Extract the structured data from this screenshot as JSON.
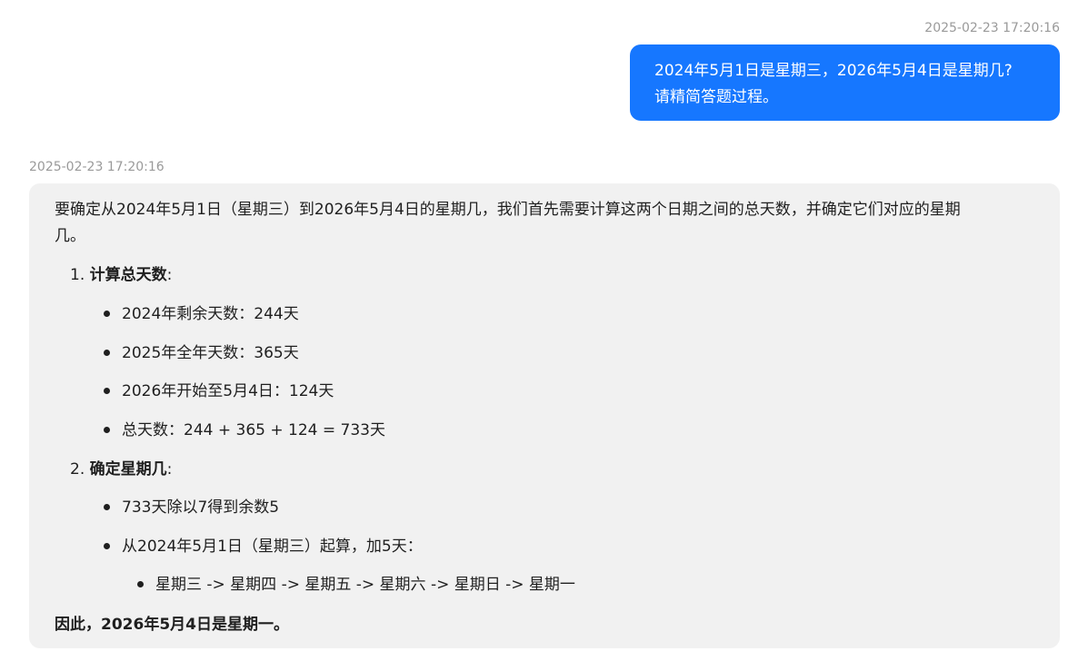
{
  "user_message": {
    "timestamp": "2025-02-23 17:20:16",
    "line1": "2024年5月1日是星期三，2026年5月4日是星期几?",
    "line2": "请精简答题过程。"
  },
  "bot_message": {
    "timestamp": "2025-02-23 17:20:16",
    "intro_line1": "要确定从2024年5月1日（星期三）到2026年5月4日的星期几，我们首先需要计算这两个日期之间的总天数，并确定它们对应的星期",
    "intro_line2": "几。",
    "step1": {
      "number": "1.",
      "title": "计算总天数",
      "colon": ":",
      "bullets": [
        "2024年剩余天数：244天",
        "2025年全年天数：365天",
        "2026年开始至5月4日：124天",
        "总天数：244 + 365 + 124 = 733天"
      ]
    },
    "step2": {
      "number": "2.",
      "title": "确定星期几",
      "colon": ":",
      "bullets": [
        "733天除以7得到余数5",
        "从2024年5月1日（星期三）起算，加5天："
      ],
      "sub_bullets": [
        "星期三 -> 星期四 -> 星期五 -> 星期六 -> 星期日 -> 星期一"
      ]
    },
    "conclusion": "因此，2026年5月4日是星期一。"
  }
}
